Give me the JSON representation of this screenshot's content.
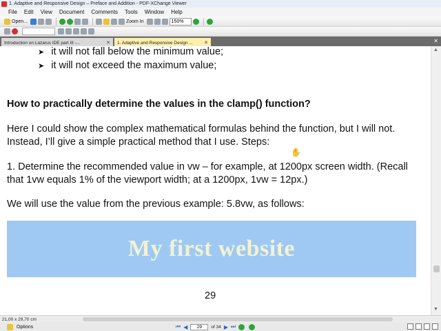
{
  "window": {
    "title": "1. Adaptive and Responsive Design – Preface and Addition - PDF-XChange Viewer"
  },
  "menu": [
    "File",
    "Edit",
    "View",
    "Document",
    "Comments",
    "Tools",
    "Window",
    "Help"
  ],
  "toolbar": {
    "open_label": "Open...",
    "zoom_in_label": "Zoom In",
    "zoom_value": "150%"
  },
  "tabs": [
    {
      "label": "Introduction on Lazarus IDE part III -...",
      "active": false
    },
    {
      "label": "1. Adaptive and Responsive Design ...",
      "active": true
    }
  ],
  "document": {
    "bullets": [
      "it will not fall below the minimum value;",
      "it will not exceed the maximum value;"
    ],
    "heading": "How to practically determine the values in the clamp() function?",
    "paragraph1": "Here I could show the complex mathematical formulas behind the function, but I will not. Instead, I’ll give a simple practical method that I use. Steps:",
    "paragraph2": "1. Determine the recommended value in vw – for example, at 1200px screen width. (Recall that 1vw equals 1% of the viewport width; at a 1200px, 1vw = 12px.)",
    "paragraph3": "We will use the value from the previous example: 5.8vw, as follows:",
    "banner_text": "My first website",
    "page_number": "29"
  },
  "status": {
    "page_size": "21,00 x 29,70 cm",
    "options_label": "Options",
    "current_page": "29",
    "of_pages": "of 34"
  },
  "colors": {
    "banner_bg": "#9fc9f3",
    "banner_text": "#f2f2d4",
    "active_tab": "#fcefb0"
  }
}
